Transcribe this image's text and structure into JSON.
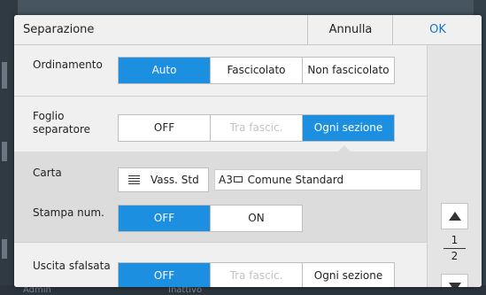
{
  "background": {
    "status_left": "Admin",
    "status_center": "Inattivo"
  },
  "dialog": {
    "title": "Separazione",
    "cancel_label": "Annulla",
    "ok_label": "OK"
  },
  "ordinamento": {
    "label": "Ordinamento",
    "options": [
      {
        "label": "Auto",
        "state": "active"
      },
      {
        "label": "Fascicolato",
        "state": "normal"
      },
      {
        "label": "Non fascicolato",
        "state": "normal"
      }
    ]
  },
  "foglio_separatore": {
    "label_line1": "Foglio",
    "label_line2": "separatore",
    "options": [
      {
        "label": "OFF",
        "state": "normal"
      },
      {
        "label": "Tra fascic.",
        "state": "disabled"
      },
      {
        "label": "Ogni sezione",
        "state": "active"
      }
    ]
  },
  "carta": {
    "label": "Carta",
    "tray_button": "Vass. Std",
    "paper_size": "A3",
    "paper_type": "Comune Standard"
  },
  "stampa_num": {
    "label": "Stampa num.",
    "options": [
      {
        "label": "OFF",
        "state": "active"
      },
      {
        "label": "ON",
        "state": "normal"
      }
    ]
  },
  "uscita_sfalsata": {
    "label": "Uscita sfalsata",
    "options": [
      {
        "label": "OFF",
        "state": "active"
      },
      {
        "label": "Tra fascic.",
        "state": "disabled"
      },
      {
        "label": "Ogni sezione",
        "state": "normal"
      }
    ]
  },
  "pager": {
    "current": "1",
    "total": "2"
  },
  "colors": {
    "accent": "#1d8fe0",
    "ok_text": "#1a73c7",
    "disabled_text": "#c4c4c4"
  }
}
